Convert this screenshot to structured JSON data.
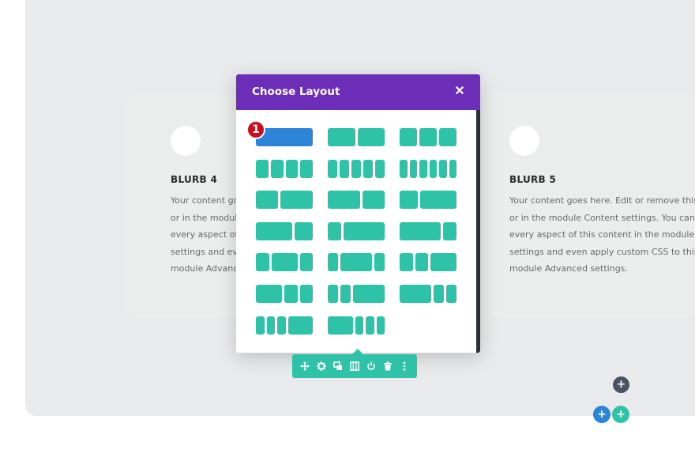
{
  "blurbs": [
    {
      "title": "BLURB 4",
      "lines": [
        "Your content goes here. Edit or remove this text inline",
        "or in the module Content settings. You can also style",
        "every aspect of this content in the module Design",
        "settings and even apply custom CSS to this text in the",
        "module Advanced settings."
      ]
    },
    {
      "title": "BLURB 5",
      "lines": [
        "Your content goes here. Edit or remove this text inline",
        "or in the module Content settings. You can also style",
        "every aspect of this content in the module Design",
        "settings and even apply custom CSS to this text in the",
        "module Advanced settings."
      ]
    }
  ],
  "modal": {
    "title": "Choose Layout",
    "close_icon": "close-icon",
    "layouts": [
      {
        "id": "1",
        "cols": [
          1
        ],
        "selected": true
      },
      {
        "id": "1_2,1_2",
        "cols": [
          1,
          1
        ]
      },
      {
        "id": "1_3,1_3,1_3",
        "cols": [
          1,
          1,
          1
        ]
      },
      {
        "id": "1_4x4",
        "cols": [
          1,
          1,
          1,
          1
        ]
      },
      {
        "id": "1_5x5",
        "cols": [
          1,
          1,
          1,
          1,
          1
        ]
      },
      {
        "id": "1_6x6",
        "cols": [
          1,
          1,
          1,
          1,
          1,
          1
        ]
      },
      {
        "id": "2_5,3_5",
        "cols": [
          2,
          3
        ]
      },
      {
        "id": "3_5,2_5",
        "cols": [
          3,
          2
        ]
      },
      {
        "id": "1_3,2_3",
        "cols": [
          1,
          2
        ]
      },
      {
        "id": "2_3,1_3",
        "cols": [
          2,
          1
        ]
      },
      {
        "id": "1_4,3_4",
        "cols": [
          1,
          3
        ]
      },
      {
        "id": "3_4,1_4",
        "cols": [
          3,
          1
        ]
      },
      {
        "id": "1_4,1_2,1_4",
        "cols": [
          1,
          2,
          1
        ]
      },
      {
        "id": "1_5,3_5,1_5",
        "cols": [
          1,
          3,
          1
        ]
      },
      {
        "id": "1_4,1_4,1_2",
        "cols": [
          1,
          1,
          2
        ]
      },
      {
        "id": "1_2,1_4,1_4",
        "cols": [
          2,
          1,
          1
        ]
      },
      {
        "id": "1_5,1_5,3_5",
        "cols": [
          1,
          1,
          3
        ]
      },
      {
        "id": "3_5,1_5,1_5",
        "cols": [
          3,
          1,
          1
        ]
      },
      {
        "id": "1_6,1_6,1_6,1_2",
        "cols": [
          1,
          1,
          1,
          3
        ]
      },
      {
        "id": "1_2,1_6,1_6,1_6",
        "cols": [
          3,
          1,
          1,
          1
        ]
      }
    ]
  },
  "annotation": {
    "step": "1"
  },
  "toolbar": {
    "buttons": [
      "move-icon",
      "gear-icon",
      "duplicate-icon",
      "columns-icon",
      "power-icon",
      "trash-icon",
      "more-icon"
    ]
  },
  "fabs": {
    "add_module": "+",
    "add_row": "+",
    "add_section": "+"
  },
  "colors": {
    "accent_purple": "#6c2eb9",
    "teal": "#2ec2a8",
    "blue": "#2d83d6",
    "badge_red": "#c8101d",
    "dark": "#4a5364"
  }
}
